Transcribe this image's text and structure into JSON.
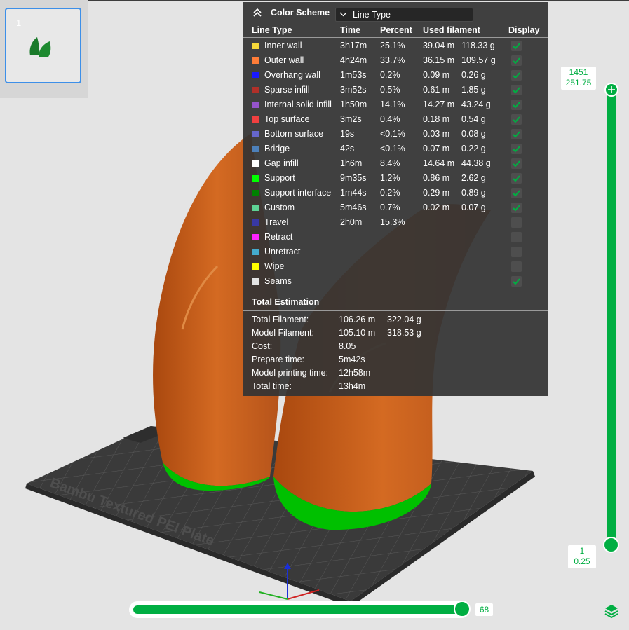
{
  "plate": {
    "number": "1"
  },
  "legend": {
    "title": "Color Scheme",
    "scheme_value": "Line Type",
    "columns": {
      "type": "Line Type",
      "time": "Time",
      "percent": "Percent",
      "used": "Used filament",
      "display": "Display"
    },
    "rows": [
      {
        "name": "Inner wall",
        "time": "3h17m",
        "percent": "25.1%",
        "length": "39.04 m",
        "weight": "118.33 g",
        "color": "#f5d83a",
        "display": true,
        "enabled": true
      },
      {
        "name": "Outer wall",
        "time": "4h24m",
        "percent": "33.7%",
        "length": "36.15 m",
        "weight": "109.57 g",
        "color": "#ff7d38",
        "display": true,
        "enabled": true
      },
      {
        "name": "Overhang wall",
        "time": "1m53s",
        "percent": "0.2%",
        "length": "0.09 m",
        "weight": "0.26 g",
        "color": "#1919ff",
        "display": true,
        "enabled": true
      },
      {
        "name": "Sparse infill",
        "time": "3m52s",
        "percent": "0.5%",
        "length": "0.61 m",
        "weight": "1.85 g",
        "color": "#b03029",
        "display": true,
        "enabled": true
      },
      {
        "name": "Internal solid infill",
        "time": "1h50m",
        "percent": "14.1%",
        "length": "14.27 m",
        "weight": "43.24 g",
        "color": "#9654cc",
        "display": true,
        "enabled": true
      },
      {
        "name": "Top surface",
        "time": "3m2s",
        "percent": "0.4%",
        "length": "0.18 m",
        "weight": "0.54 g",
        "color": "#f04040",
        "display": true,
        "enabled": true
      },
      {
        "name": "Bottom surface",
        "time": "19s",
        "percent": "<0.1%",
        "length": "0.03 m",
        "weight": "0.08 g",
        "color": "#6666cc",
        "display": true,
        "enabled": true
      },
      {
        "name": "Bridge",
        "time": "42s",
        "percent": "<0.1%",
        "length": "0.07 m",
        "weight": "0.22 g",
        "color": "#4d80ba",
        "display": true,
        "enabled": true
      },
      {
        "name": "Gap infill",
        "time": "1h6m",
        "percent": "8.4%",
        "length": "14.64 m",
        "weight": "44.38 g",
        "color": "#ffffff",
        "display": true,
        "enabled": true
      },
      {
        "name": "Support",
        "time": "9m35s",
        "percent": "1.2%",
        "length": "0.86 m",
        "weight": "2.62 g",
        "color": "#00ff00",
        "display": true,
        "enabled": true
      },
      {
        "name": "Support interface",
        "time": "1m44s",
        "percent": "0.2%",
        "length": "0.29 m",
        "weight": "0.89 g",
        "color": "#008000",
        "display": true,
        "enabled": true
      },
      {
        "name": "Custom",
        "time": "5m46s",
        "percent": "0.7%",
        "length": "0.02 m",
        "weight": "0.07 g",
        "color": "#5ed194",
        "display": true,
        "enabled": true
      },
      {
        "name": "Travel",
        "time": "2h0m",
        "percent": "15.3%",
        "length": "",
        "weight": "",
        "color": "#3838a3",
        "display": false,
        "enabled": true
      },
      {
        "name": "Retract",
        "time": "",
        "percent": "",
        "length": "",
        "weight": "",
        "color": "#ff22ff",
        "display": false,
        "enabled": true
      },
      {
        "name": "Unretract",
        "time": "",
        "percent": "",
        "length": "",
        "weight": "",
        "color": "#44aacc",
        "display": false,
        "enabled": true
      },
      {
        "name": "Wipe",
        "time": "",
        "percent": "",
        "length": "",
        "weight": "",
        "color": "#ffff00",
        "display": false,
        "enabled": true
      },
      {
        "name": "Seams",
        "time": "",
        "percent": "",
        "length": "",
        "weight": "",
        "color": "#e3e3e3",
        "display": true,
        "enabled": true
      }
    ],
    "total": {
      "title": "Total Estimation",
      "rows": [
        {
          "label": "Total Filament:",
          "v1": "106.26 m",
          "v2": "322.04 g"
        },
        {
          "label": "Model Filament:",
          "v1": "105.10 m",
          "v2": "318.53 g"
        },
        {
          "label": "Cost:",
          "v1": "8.05",
          "v2": ""
        },
        {
          "label": "Prepare time:",
          "v1": "5m42s",
          "v2": ""
        },
        {
          "label": "Model printing time:",
          "v1": "12h58m",
          "v2": ""
        },
        {
          "label": "Total time:",
          "v1": "13h4m",
          "v2": ""
        }
      ]
    }
  },
  "layer_slider": {
    "top_layer": "1451",
    "top_height": "251.75",
    "bottom_layer": "1",
    "bottom_height": "0.25"
  },
  "move_slider": {
    "value": "68"
  },
  "plate_label": "Bambu Textured PEI Plate",
  "colors": {
    "accent": "#00ae42",
    "model": "#c8601c",
    "panel": "#343434",
    "plate": "#3a3a3a"
  },
  "icons": {
    "collapse": "double-chevron-up-icon",
    "dropdown": "chevron-down-icon",
    "layers": "layers-icon",
    "add": "plus-icon"
  }
}
